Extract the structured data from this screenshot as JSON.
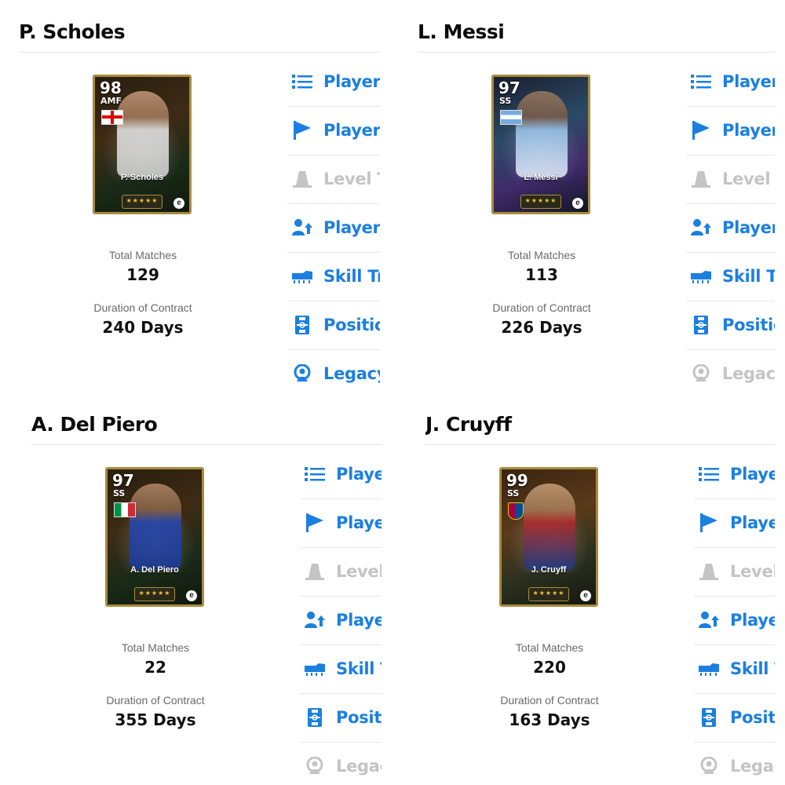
{
  "colors": {
    "accent": "#1b7fe0",
    "disabled": "#c4c4c4",
    "card_border": "#a88c3c"
  },
  "menu_labels": {
    "player_details": "Player Details",
    "player_profile": "Player Profile",
    "level_training": "Level Training",
    "player_progression": "Player Progression",
    "skill_training": "Skill Training",
    "position_training": "Position Training",
    "legacy": "Legacy"
  },
  "players": [
    {
      "name": "P. Scholes",
      "card_name": "P. Scholes",
      "rating": "98",
      "position": "AMF",
      "flag": "england",
      "total_matches_label": "Total Matches",
      "total_matches": "129",
      "contract_label": "Duration of Contract",
      "contract": "240 Days",
      "legacy_enabled": true
    },
    {
      "name": "L. Messi",
      "card_name": "L. Messi",
      "rating": "97",
      "position": "SS",
      "flag": "argentina",
      "total_matches_label": "Total Matches",
      "total_matches": "113",
      "contract_label": "Duration of Contract",
      "contract": "226 Days",
      "legacy_enabled": false
    },
    {
      "name": "A. Del Piero",
      "card_name": "A. Del Piero",
      "rating": "97",
      "position": "SS",
      "flag": "italy",
      "total_matches_label": "Total Matches",
      "total_matches": "22",
      "contract_label": "Duration of Contract",
      "contract": "355 Days",
      "legacy_enabled": false
    },
    {
      "name": "J. Cruyff",
      "card_name": "J. Cruyff",
      "rating": "99",
      "position": "SS",
      "flag": "fc-barcelona",
      "total_matches_label": "Total Matches",
      "total_matches": "220",
      "contract_label": "Duration of Contract",
      "contract": "163 Days",
      "legacy_enabled": false
    }
  ],
  "icons": [
    "list-icon",
    "flag-icon",
    "cone-icon",
    "person-up-icon",
    "boot-icon",
    "pitch-icon",
    "legacy-icon"
  ]
}
